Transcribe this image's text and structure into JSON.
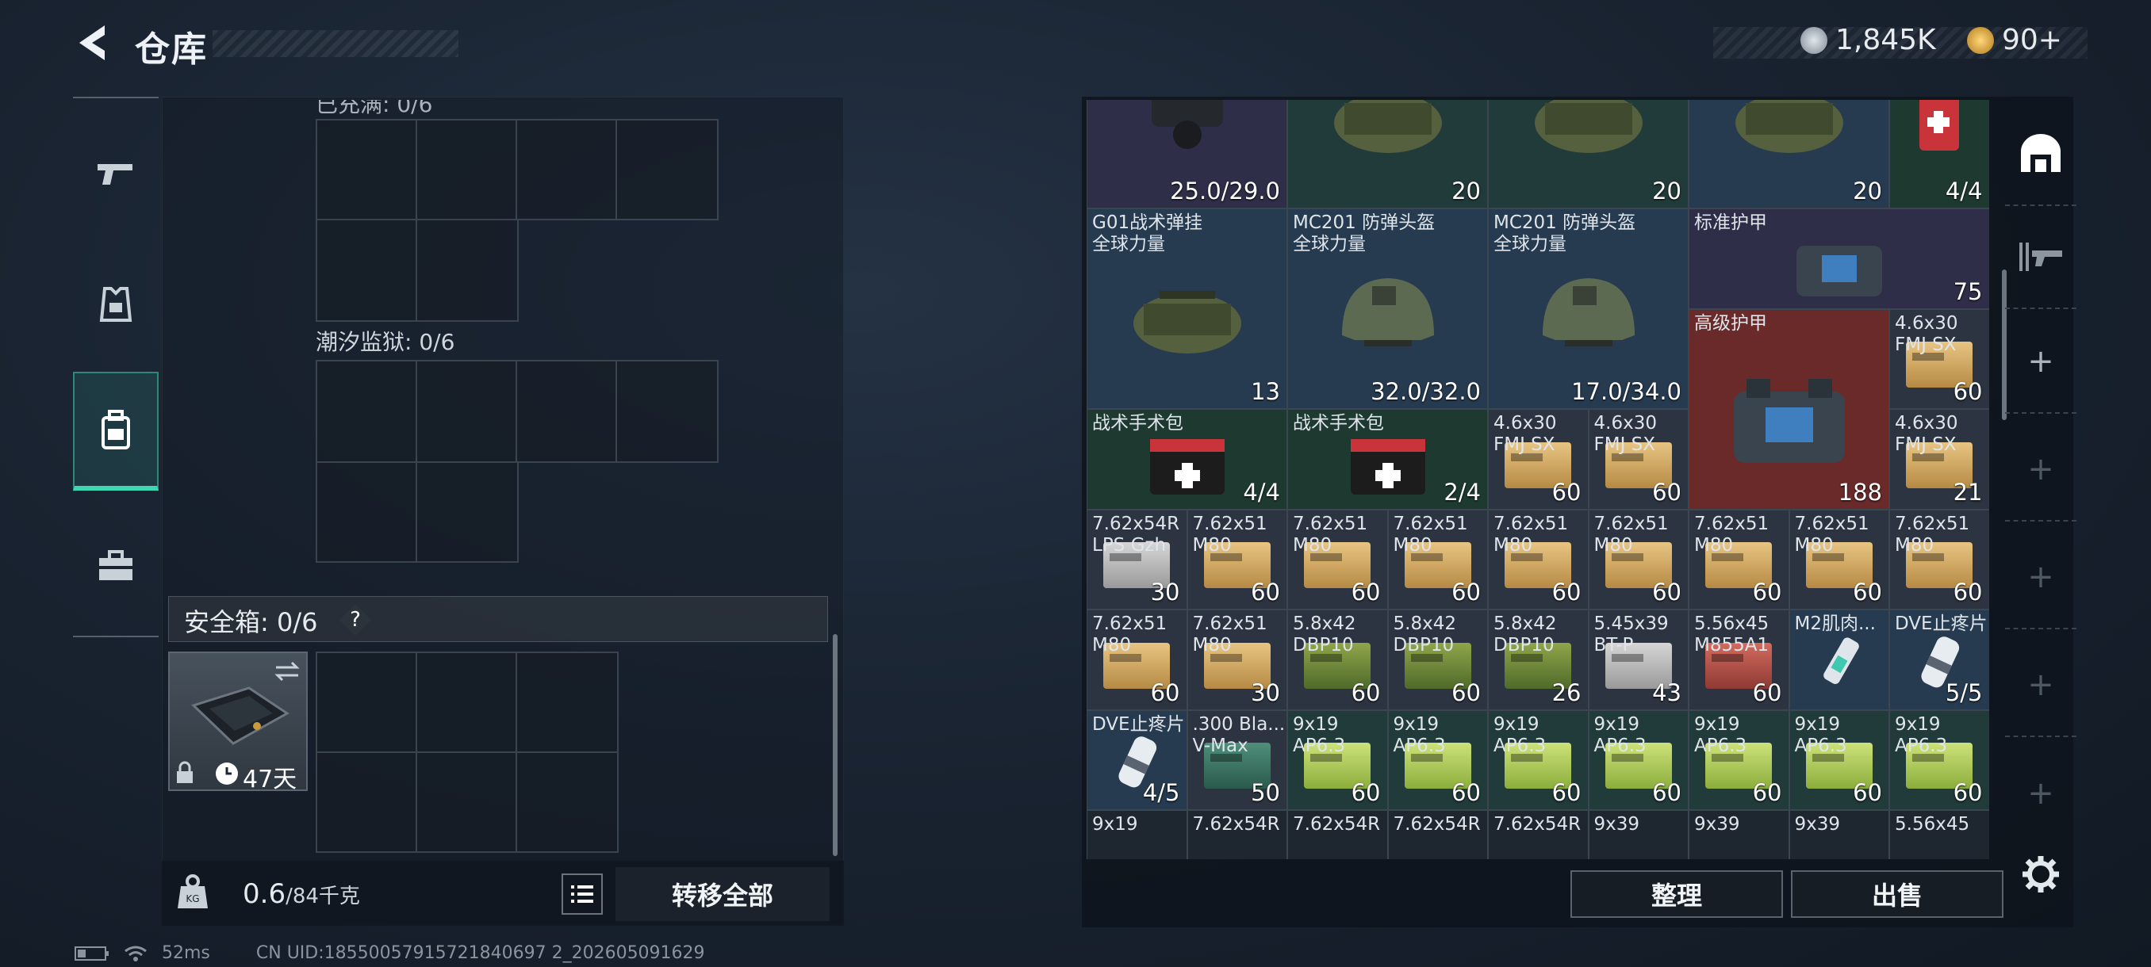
{
  "header": {
    "title": "仓库",
    "currency_primary": "1,845K",
    "currency_secondary": "90+",
    "colors": {
      "primary_coin": "#b8c2cc",
      "secondary_coin": "#e0b04a"
    }
  },
  "left_nav": {
    "items": [
      {
        "icon": "pistol-icon"
      },
      {
        "icon": "chest-rig-icon"
      },
      {
        "icon": "backpack-icon",
        "active": true
      },
      {
        "icon": "toolbox-icon"
      }
    ]
  },
  "containers": {
    "top_label_partial": "已充满: 0/6",
    "tide_prison_label": "潮汐监狱: 0/6",
    "secure_box_label": "安全箱: 0/6",
    "help": "?",
    "case_timer": "47天"
  },
  "weight": {
    "current": "0.6",
    "capacity": "/84千克"
  },
  "transfer_all": "转移全部",
  "actions": {
    "organize": "整理",
    "sell": "出售"
  },
  "status": {
    "ping": "52ms",
    "uid": "CN UID:18550057915721840697 2_202605091629"
  },
  "inventory": {
    "row0": [
      {
        "name": "",
        "qty": "25.0/29.0",
        "pic": "helmet-visor"
      },
      {
        "name": "",
        "qty": "20",
        "pic": "bag-olive"
      },
      {
        "name": "",
        "qty": "20",
        "pic": "bag-olive"
      },
      {
        "name": "",
        "qty": "20",
        "pic": "bag-olive"
      },
      {
        "name": "",
        "qty": "4/4",
        "pic": "medkit"
      }
    ],
    "big": [
      {
        "name": "G01战术弹挂\n全球力量",
        "qty": "13"
      },
      {
        "name": "MC201 防弹头盔\n全球力量",
        "qty": "32.0/32.0"
      },
      {
        "name": "MC201 防弹头盔\n全球力量",
        "qty": "17.0/34.0"
      },
      {
        "name": "标准护甲",
        "qty": "75"
      },
      {
        "name": "高级护甲",
        "qty": "188"
      },
      {
        "name": "4.6x30\nFMJ SX",
        "qty": "60"
      },
      {
        "name": "战术手术包",
        "qty": "4/4"
      },
      {
        "name": "战术手术包",
        "qty": "2/4"
      },
      {
        "name": "4.6x30\nFMJ SX",
        "qty": "60"
      },
      {
        "name": "4.6x30\nFMJ SX",
        "qty": "60"
      },
      {
        "name": "4.6x30\nFMJ SX",
        "qty": "21"
      }
    ],
    "row_a": [
      {
        "name": "7.62x54R\nLPS Gzh",
        "qty": "30"
      },
      {
        "name": "7.62x51\nM80",
        "qty": "60"
      },
      {
        "name": "7.62x51\nM80",
        "qty": "60"
      },
      {
        "name": "7.62x51\nM80",
        "qty": "60"
      },
      {
        "name": "7.62x51\nM80",
        "qty": "60"
      },
      {
        "name": "7.62x51\nM80",
        "qty": "60"
      },
      {
        "name": "7.62x51\nM80",
        "qty": "60"
      },
      {
        "name": "7.62x51\nM80",
        "qty": "60"
      },
      {
        "name": "7.62x51\nM80",
        "qty": "60"
      }
    ],
    "row_b": [
      {
        "name": "7.62x51\nM80",
        "qty": "60"
      },
      {
        "name": "7.62x51\nM80",
        "qty": "30"
      },
      {
        "name": "5.8x42\nDBP10",
        "qty": "60"
      },
      {
        "name": "5.8x42\nDBP10",
        "qty": "60"
      },
      {
        "name": "5.8x42\nDBP10",
        "qty": "26"
      },
      {
        "name": "5.45x39\nBT-P",
        "qty": "43"
      },
      {
        "name": "5.56x45\nM855A1",
        "qty": "60"
      },
      {
        "name": "M2肌肉...",
        "qty": ""
      },
      {
        "name": "DVE止疼片",
        "qty": "5/5"
      }
    ],
    "row_c": [
      {
        "name": "DVE止疼片",
        "qty": "4/5"
      },
      {
        "name": ".300 Bla...\nV-Max",
        "qty": "50"
      },
      {
        "name": "9x19\nAP6.3",
        "qty": "60"
      },
      {
        "name": "9x19\nAP6.3",
        "qty": "60"
      },
      {
        "name": "9x19\nAP6.3",
        "qty": "60"
      },
      {
        "name": "9x19\nAP6.3",
        "qty": "60"
      },
      {
        "name": "9x19\nAP6.3",
        "qty": "60"
      },
      {
        "name": "9x19\nAP6.3",
        "qty": "60"
      },
      {
        "name": "9x19\nAP6.3",
        "qty": "60"
      }
    ],
    "row_d": [
      {
        "name": "9x19"
      },
      {
        "name": "7.62x54R"
      },
      {
        "name": "7.62x54R"
      },
      {
        "name": "7.62x54R"
      },
      {
        "name": "7.62x54R"
      },
      {
        "name": "9x39"
      },
      {
        "name": "9x39"
      },
      {
        "name": "9x39"
      },
      {
        "name": "5.56x45"
      }
    ]
  }
}
